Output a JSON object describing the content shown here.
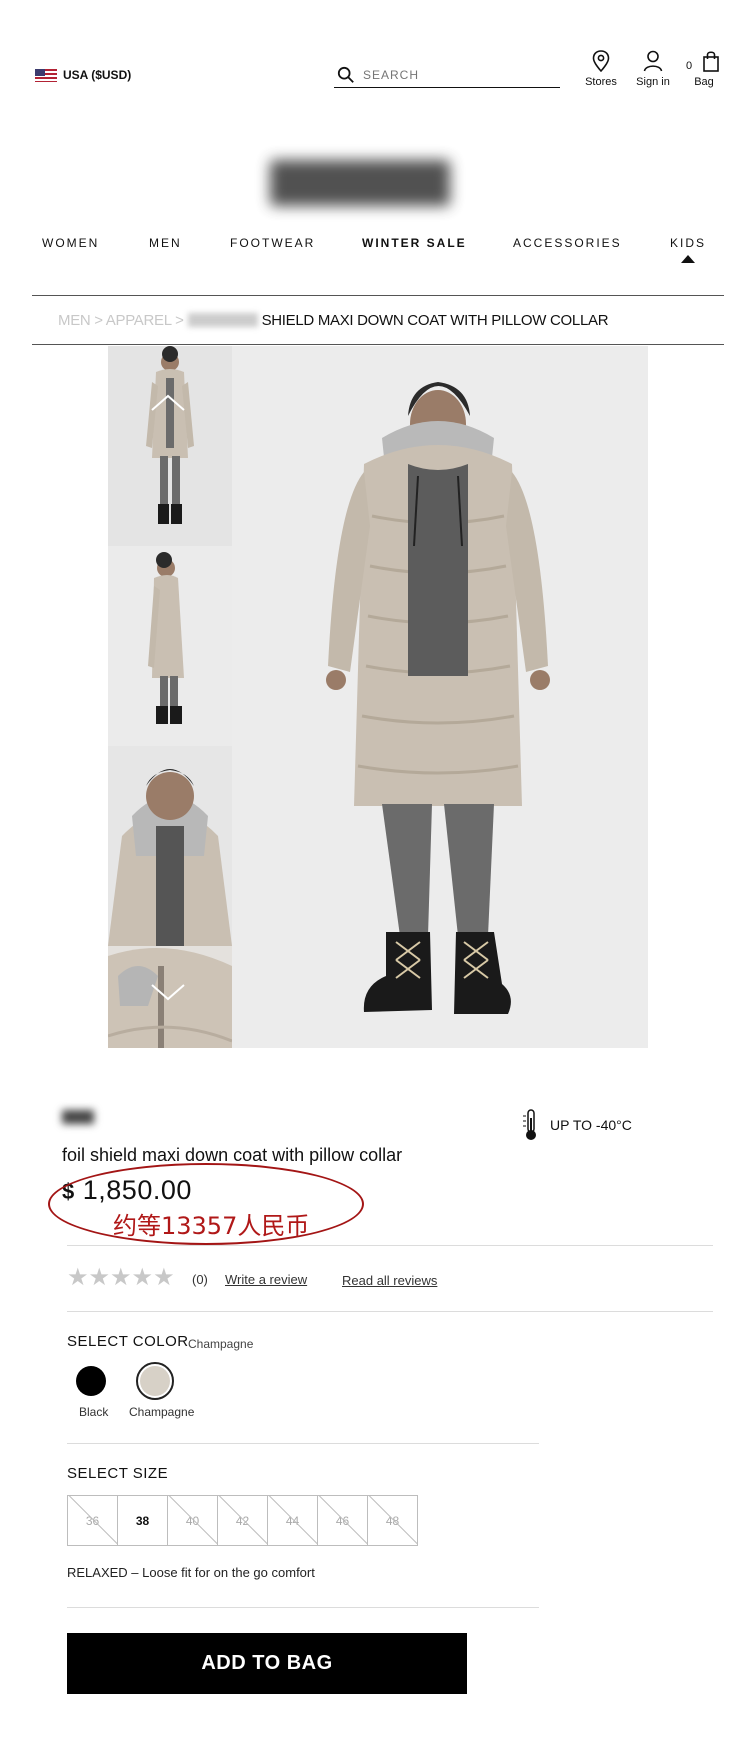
{
  "header": {
    "locale": "USA ($USD)",
    "search_placeholder": "SEARCH",
    "stores_label": "Stores",
    "signin_label": "Sign in",
    "bag_label": "Bag",
    "bag_count": "0"
  },
  "nav": {
    "items": [
      "WOMEN",
      "MEN",
      "FOOTWEAR",
      "WINTER SALE",
      "ACCESSORIES",
      "KIDS"
    ]
  },
  "breadcrumb": {
    "path": "MEN > APPAREL > ",
    "current": "SHIELD MAXI DOWN COAT WITH PILLOW COLLAR"
  },
  "product": {
    "name": "foil shield maxi down coat with pillow collar",
    "currency_symbol": "$",
    "price": "1,850.00",
    "rmb_note": "约等13357人民币",
    "temperature": "UP TO -40°C",
    "rating": 0,
    "review_count": "(0)",
    "write_review": "Write a review",
    "read_reviews": "Read all reviews",
    "fit_note": "RELAXED – Loose fit for on the go comfort",
    "add_to_bag": "ADD TO BAG"
  },
  "color": {
    "label": "SELECT COLOR",
    "selected": "Champagne",
    "options": [
      {
        "name": "Black",
        "hex": "#000000"
      },
      {
        "name": "Champagne",
        "hex": "#d7d1c7"
      }
    ]
  },
  "size": {
    "label": "SELECT SIZE",
    "options": [
      "36",
      "38",
      "40",
      "42",
      "44",
      "46",
      "48"
    ],
    "available": [
      "38"
    ]
  },
  "colors": {
    "accent_annotation": "#a31515",
    "coat": "#c9bfb2",
    "button": "#000000"
  }
}
